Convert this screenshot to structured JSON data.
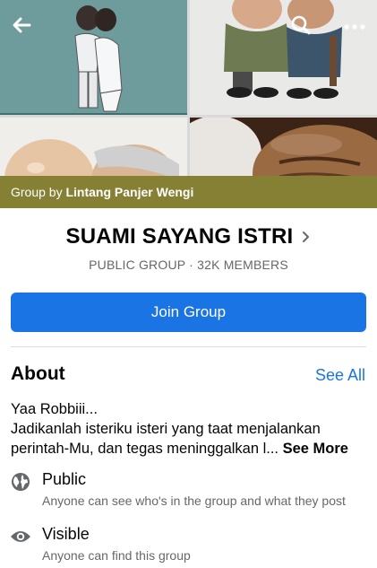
{
  "cover": {
    "group_by_prefix": "Group by",
    "group_by_name": "Lintang Panjer Wengi"
  },
  "group": {
    "title": "SUAMI SAYANG ISTRI",
    "meta": "PUBLIC GROUP · 32K MEMBERS"
  },
  "actions": {
    "join_label": "Join Group"
  },
  "about": {
    "heading": "About",
    "see_all_label": "See All",
    "description_line1": "Yaa Robbiii...",
    "description_line2": "Jadikanlah isteriku isteri yang taat menjalankan perintah-Mu, dan tegas meninggalkan l...",
    "see_more_label": "See More"
  },
  "info": {
    "privacy_title": "Public",
    "privacy_desc": "Anyone can see who's in the group and what they post",
    "visibility_title": "Visible",
    "visibility_desc": "Anyone can find this group"
  },
  "colors": {
    "accent": "#1b74e4",
    "banner": "#858033",
    "secondary_text": "#65676b"
  },
  "icons": [
    "back-arrow-icon",
    "search-icon",
    "more-icon",
    "chevron-right-icon",
    "globe-icon",
    "eye-icon"
  ]
}
